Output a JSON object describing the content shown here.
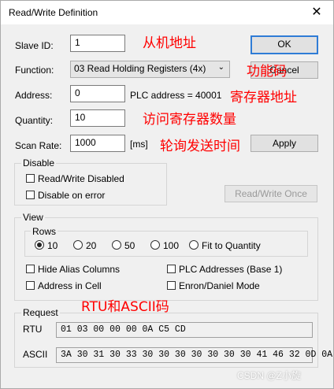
{
  "window": {
    "title": "Read/Write Definition",
    "close_glyph": "✕"
  },
  "form": {
    "slave_id_label": "Slave ID:",
    "slave_id_value": "1",
    "function_label": "Function:",
    "function_value": "03 Read Holding Registers (4x)",
    "address_label": "Address:",
    "address_value": "0",
    "plc_address_text": "PLC address = 40001",
    "quantity_label": "Quantity:",
    "quantity_value": "10",
    "scan_rate_label": "Scan Rate:",
    "scan_rate_value": "1000",
    "scan_rate_unit": "[ms]"
  },
  "buttons": {
    "ok": "OK",
    "cancel": "Cancel",
    "apply": "Apply",
    "read_write_once": "Read/Write Once"
  },
  "disable": {
    "title": "Disable",
    "read_write_disabled": "Read/Write Disabled",
    "disable_on_error": "Disable on error"
  },
  "view": {
    "title": "View",
    "rows_title": "Rows",
    "rows_options": [
      "10",
      "20",
      "50",
      "100",
      "Fit to Quantity"
    ],
    "rows_selected": "10",
    "hide_alias_columns": "Hide Alias Columns",
    "address_in_cell": "Address in Cell",
    "plc_addresses_base1": "PLC Addresses (Base 1)",
    "enron_daniel_mode": "Enron/Daniel Mode"
  },
  "request": {
    "title": "Request",
    "rtu_label": "RTU",
    "rtu_value": "01 03 00 00 00 0A C5 CD",
    "ascii_label": "ASCII",
    "ascii_value": "3A 30 31 30 33 30 30 30 30 30 30 30 41 46 32 0D 0A"
  },
  "annotations": {
    "slave_id": "从机地址",
    "function": "功能码",
    "address": "寄存器地址",
    "quantity": "访问寄存器数量",
    "scan_rate": "轮询发送时间",
    "request": "RTU和ASCII码"
  },
  "watermark": "CSDN @Z小旋",
  "colors": {
    "annotation": "#ff0000",
    "default_button_border": "#2f7cd6"
  }
}
